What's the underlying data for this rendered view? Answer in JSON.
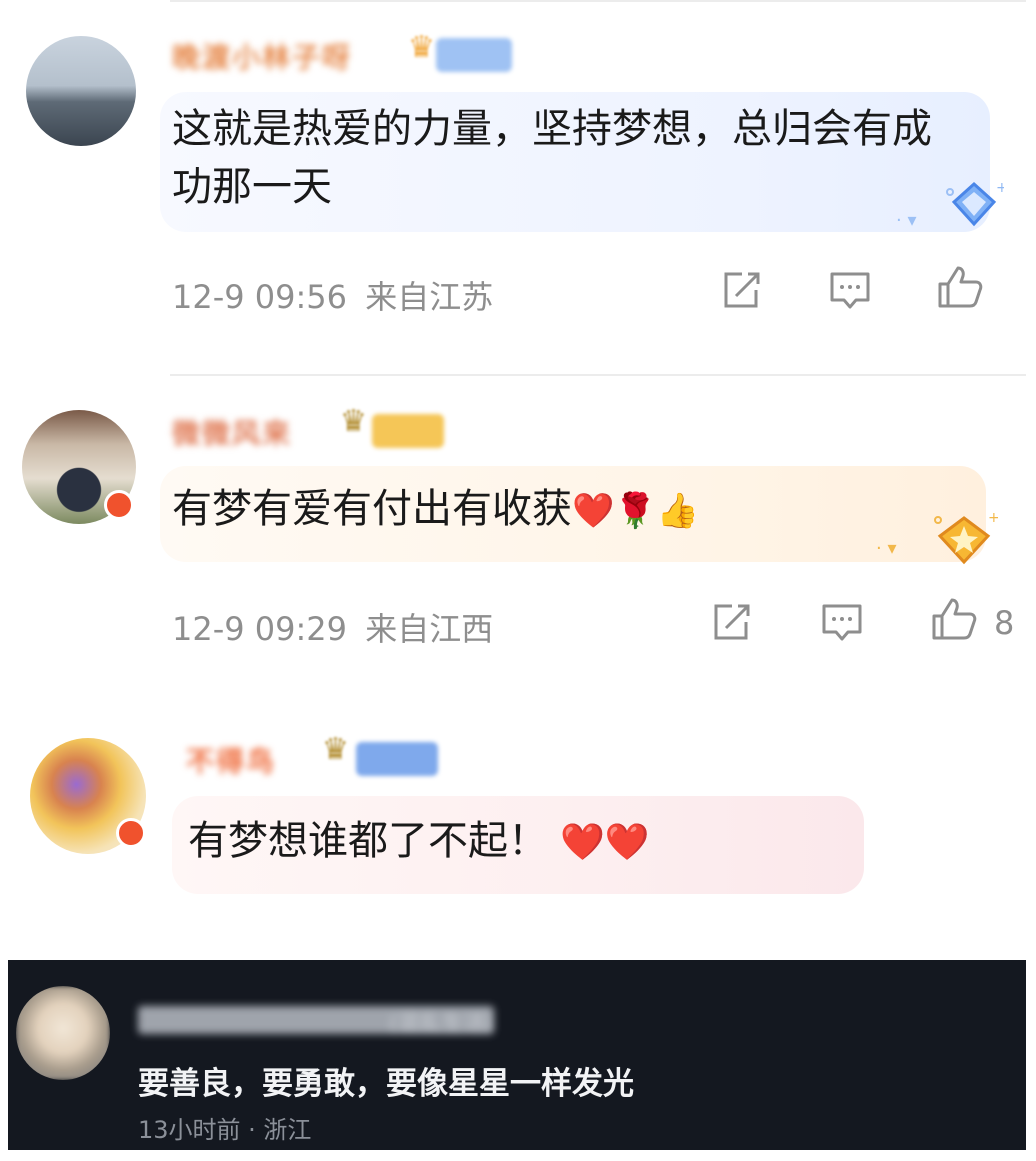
{
  "comments": [
    {
      "username": "晚渡小林子呀",
      "text": "这就是热爱的力量，坚持梦想，总归会有成功那一天",
      "time": "12-9 09:56",
      "location": "来自江苏",
      "likes": ""
    },
    {
      "username": "微微风来",
      "text": "有梦有爱有付出有收获",
      "emoji": "❤️🌹👍",
      "time": "12-9 09:29",
      "location": "来自江西",
      "likes": "8"
    },
    {
      "username": "不得鸟",
      "text": "有梦想谁都了不起！",
      "emoji": "❤️❤️"
    }
  ],
  "dark_comment": {
    "username": "(混乱生活)",
    "text": "要善良，要勇敢，要像星星一样发光",
    "meta": "13小时前 · 浙江"
  },
  "icons": {
    "share": "share-icon",
    "reply": "comment-icon",
    "like": "thumbs-up-icon"
  },
  "colors": {
    "bubble_blue": "#eef4ff",
    "bubble_orange": "#fff4e6",
    "bubble_pink": "#fdeef0",
    "meta_gray": "#8e8e8e"
  }
}
